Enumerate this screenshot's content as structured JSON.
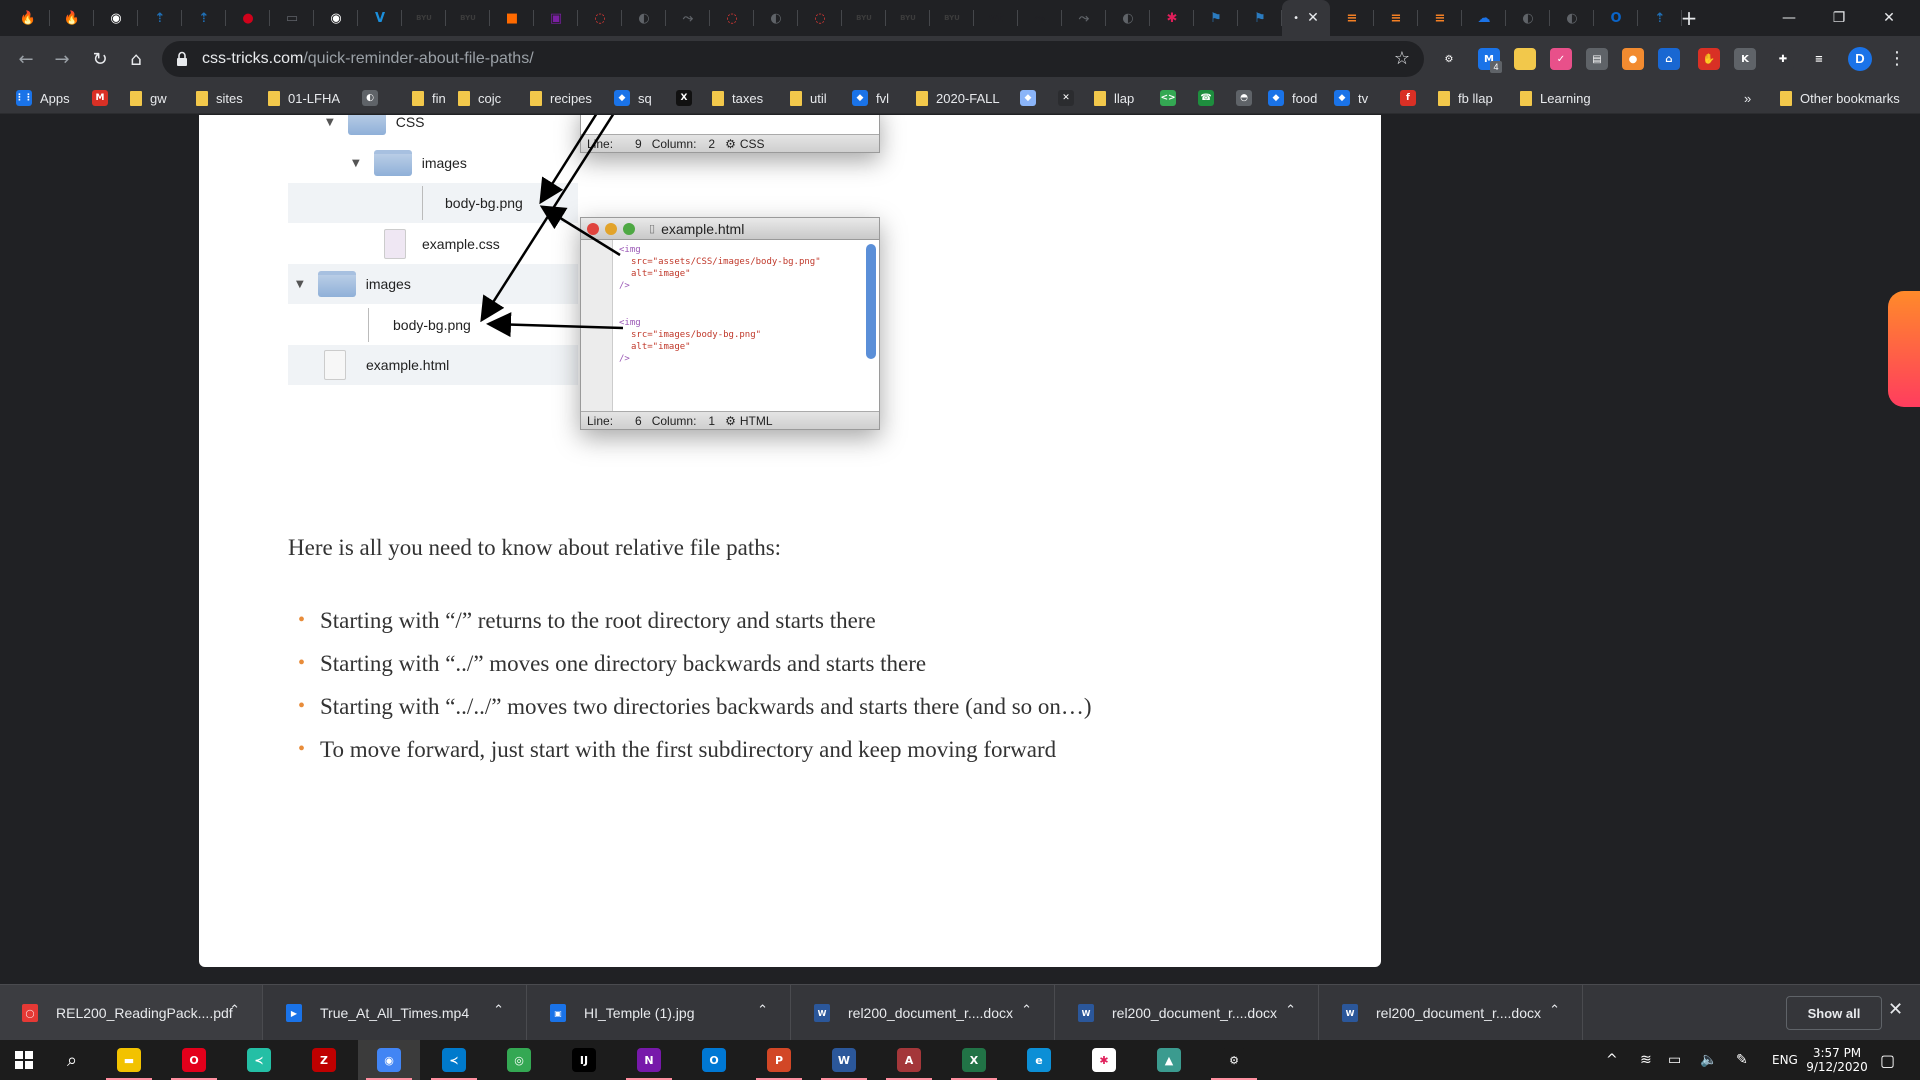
{
  "browser": {
    "tabs": [
      {
        "icon": "fire-icon",
        "color": "#f4a300",
        "glyph": "🔥"
      },
      {
        "icon": "fire-icon",
        "color": "#f4a300",
        "glyph": "🔥"
      },
      {
        "icon": "github-icon",
        "color": "#ffffff",
        "glyph": "◉"
      },
      {
        "icon": "upload-icon",
        "color": "#1f6fb5",
        "glyph": "⇡"
      },
      {
        "icon": "upload-icon",
        "color": "#1f6fb5",
        "glyph": "⇡"
      },
      {
        "icon": "red-app-icon",
        "color": "#d0021b",
        "glyph": "●"
      },
      {
        "icon": "gamepad-icon",
        "color": "#5f6368",
        "glyph": "▭"
      },
      {
        "icon": "github-icon",
        "color": "#ffffff",
        "glyph": "◉"
      },
      {
        "icon": "v-icon",
        "color": "#1b8fdc",
        "glyph": "V"
      },
      {
        "icon": "byu-icon",
        "color": "#3c3c3c",
        "glyph": "BYU"
      },
      {
        "icon": "byu-icon",
        "color": "#3c3c3c",
        "glyph": "BYU"
      },
      {
        "icon": "orange-square-icon",
        "color": "#ff6a00",
        "glyph": "■"
      },
      {
        "icon": "purple-square-icon",
        "color": "#7a1fa2",
        "glyph": "▣"
      },
      {
        "icon": "circle-red-icon",
        "color": "#e53935",
        "glyph": "◌"
      },
      {
        "icon": "globe-icon",
        "color": "#5f6368",
        "glyph": "◐"
      },
      {
        "icon": "arrow-icon",
        "color": "#5f6368",
        "glyph": "⤳"
      },
      {
        "icon": "circle-red-icon",
        "color": "#e53935",
        "glyph": "◌"
      },
      {
        "icon": "globe-icon",
        "color": "#5f6368",
        "glyph": "◐"
      },
      {
        "icon": "circle-red-icon",
        "color": "#e53935",
        "glyph": "◌"
      },
      {
        "icon": "byu-icon",
        "color": "#3c3c3c",
        "glyph": "BYU"
      },
      {
        "icon": "byu-icon",
        "color": "#3c3c3c",
        "glyph": "BYU"
      },
      {
        "icon": "byu-icon",
        "color": "#3c3c3c",
        "glyph": "BYU"
      },
      {
        "icon": "vt-icon",
        "color": "#202124",
        "glyph": "vt"
      },
      {
        "icon": "arrow-icon",
        "color": "#202124",
        "glyph": "⤳"
      },
      {
        "icon": "arrow-icon",
        "color": "#5f6368",
        "glyph": "⤳"
      },
      {
        "icon": "globe-icon",
        "color": "#5f6368",
        "glyph": "◐"
      },
      {
        "icon": "slack-icon",
        "color": "#e01e5a",
        "glyph": "✱"
      },
      {
        "icon": "flag-icon",
        "color": "#2b7bbf",
        "glyph": "⚑"
      },
      {
        "icon": "flag-icon",
        "color": "#2b7bbf",
        "glyph": "⚑"
      },
      {
        "icon": "stack-icon",
        "color": "#f48024",
        "glyph": "≡"
      },
      {
        "icon": "stack-icon",
        "color": "#f48024",
        "glyph": "≡"
      },
      {
        "icon": "stack-icon",
        "color": "#f48024",
        "glyph": "≡"
      },
      {
        "icon": "cloud-icon",
        "color": "#1b73e8",
        "glyph": "☁"
      },
      {
        "icon": "globe-icon",
        "color": "#5f6368",
        "glyph": "◐"
      },
      {
        "icon": "globe-icon",
        "color": "#5f6368",
        "glyph": "◐"
      },
      {
        "icon": "outlook-icon",
        "color": "#0a64c8",
        "glyph": "O"
      },
      {
        "icon": "upload-icon",
        "color": "#1f6fb5",
        "glyph": "⇡"
      }
    ],
    "new_tab": "+",
    "url_host": "css-tricks.com",
    "url_path": "/quick-reminder-about-file-paths/",
    "profile_initial": "D",
    "extension_badge": "4",
    "bookmarks": [
      {
        "label": "Apps",
        "type": "apps"
      },
      {
        "label": "",
        "type": "gmail"
      },
      {
        "label": "gw",
        "type": "folder"
      },
      {
        "label": "sites",
        "type": "folder"
      },
      {
        "label": "01-LFHA",
        "type": "folder"
      },
      {
        "label": "",
        "type": "globe"
      },
      {
        "label": "fin",
        "type": "folder"
      },
      {
        "label": "cojc",
        "type": "folder"
      },
      {
        "label": "recipes",
        "type": "folder"
      },
      {
        "label": "sq",
        "type": "site"
      },
      {
        "label": "",
        "type": "x"
      },
      {
        "label": "taxes",
        "type": "folder"
      },
      {
        "label": "util",
        "type": "folder"
      },
      {
        "label": "fvl",
        "type": "site"
      },
      {
        "label": "2020-FALL",
        "type": "folder"
      },
      {
        "label": "",
        "type": "diamond"
      },
      {
        "label": "",
        "type": "x-dark"
      },
      {
        "label": "llap",
        "type": "folder"
      },
      {
        "label": "",
        "type": "code"
      },
      {
        "label": "",
        "type": "phone"
      },
      {
        "label": "",
        "type": "helmet"
      },
      {
        "label": "food",
        "type": "site"
      },
      {
        "label": "tv",
        "type": "site"
      },
      {
        "label": "",
        "type": "f-icon"
      },
      {
        "label": "fb llap",
        "type": "folder"
      },
      {
        "label": "Learning",
        "type": "folder"
      }
    ],
    "bookmarks_overflow": "»",
    "other_bookmarks": "Other bookmarks"
  },
  "article": {
    "figure": {
      "tree": {
        "css_folder": "CSS",
        "images_sub": "images",
        "body_bg_1": "body-bg.png",
        "example_css": "example.css",
        "images_root": "images",
        "body_bg_2": "body-bg.png",
        "example_html": "example.html"
      },
      "css_window": {
        "status_line": "Line:",
        "line_no": "9",
        "status_col": "Column:",
        "col_no": "2",
        "lang": "CSS"
      },
      "html_window": {
        "title": "example.html",
        "code1_tag": "<img",
        "code1_src": "src=\"assets/CSS/images/body-bg.png\"",
        "code1_alt": "alt=\"image\"",
        "code1_end": "/>",
        "code2_tag": "<img",
        "code2_src": "src=\"images/body-bg.png\"",
        "code2_alt": "alt=\"image\"",
        "code2_end": "/>",
        "status_line": "Line:",
        "line_no": "6",
        "status_col": "Column:",
        "col_no": "1",
        "lang": "HTML"
      }
    },
    "intro": "Here is all you need to know about relative file paths:",
    "bullets": [
      "Starting with “/” returns to the root directory and starts there",
      "Starting with “../” moves one directory backwards and starts there",
      "Starting with “../../” moves two directories backwards and starts there (and so on…)",
      "To move forward, just start with the first subdirectory and keep moving forward"
    ]
  },
  "downloads": {
    "items": [
      {
        "name": "REL200_ReadingPack....pdf",
        "icon": "pdf-icon",
        "color": "#e53935",
        "glyph": "◯"
      },
      {
        "name": "True_At_All_Times.mp4",
        "icon": "video-file-icon",
        "color": "#1a73e8",
        "glyph": "▶"
      },
      {
        "name": "HI_Temple (1).jpg",
        "icon": "image-file-icon",
        "color": "#1a73e8",
        "glyph": "▣"
      },
      {
        "name": "rel200_document_r....docx",
        "icon": "word-file-icon",
        "color": "#2b579a",
        "glyph": "W"
      },
      {
        "name": "rel200_document_r....docx",
        "icon": "word-file-icon",
        "color": "#2b579a",
        "glyph": "W"
      },
      {
        "name": "rel200_document_r....docx",
        "icon": "word-file-icon",
        "color": "#2b579a",
        "glyph": "W"
      }
    ],
    "show_all": "Show all"
  },
  "taskbar": {
    "apps": [
      {
        "icon": "file-explorer-icon",
        "color": "#f2c200",
        "glyph": "▬"
      },
      {
        "icon": "opera-icon",
        "color": "#e3001b",
        "glyph": "O"
      },
      {
        "icon": "vs-code-insiders-icon",
        "color": "#24bfa5",
        "glyph": "≺"
      },
      {
        "icon": "filezilla-icon",
        "color": "#bf0000",
        "glyph": "Z"
      },
      {
        "icon": "chrome-icon",
        "color": "#4285f4",
        "glyph": "◉"
      },
      {
        "icon": "vs-code-icon",
        "color": "#007acc",
        "glyph": "≺"
      },
      {
        "icon": "maps-icon",
        "color": "#34a853",
        "glyph": "◎"
      },
      {
        "icon": "intellij-icon",
        "color": "#000000",
        "glyph": "IJ"
      },
      {
        "icon": "onenote-icon",
        "color": "#7719aa",
        "glyph": "N"
      },
      {
        "icon": "outlook-icon",
        "color": "#0078d4",
        "glyph": "O"
      },
      {
        "icon": "powerpoint-icon",
        "color": "#d24726",
        "glyph": "P"
      },
      {
        "icon": "word-icon",
        "color": "#2b579a",
        "glyph": "W"
      },
      {
        "icon": "access-icon",
        "color": "#a4373a",
        "glyph": "A"
      },
      {
        "icon": "excel-icon",
        "color": "#217346",
        "glyph": "X"
      },
      {
        "icon": "edge-icon",
        "color": "#0c8fd6",
        "glyph": "e"
      },
      {
        "icon": "slack-icon",
        "color": "#ffffff",
        "glyph": "✱"
      },
      {
        "icon": "photos-icon",
        "color": "#3b9b8f",
        "glyph": "▲"
      },
      {
        "icon": "settings-icon",
        "color": "#1c1c1c",
        "glyph": "⚙"
      }
    ],
    "lang": "ENG",
    "time": "3:57 PM",
    "date": "9/12/2020"
  }
}
